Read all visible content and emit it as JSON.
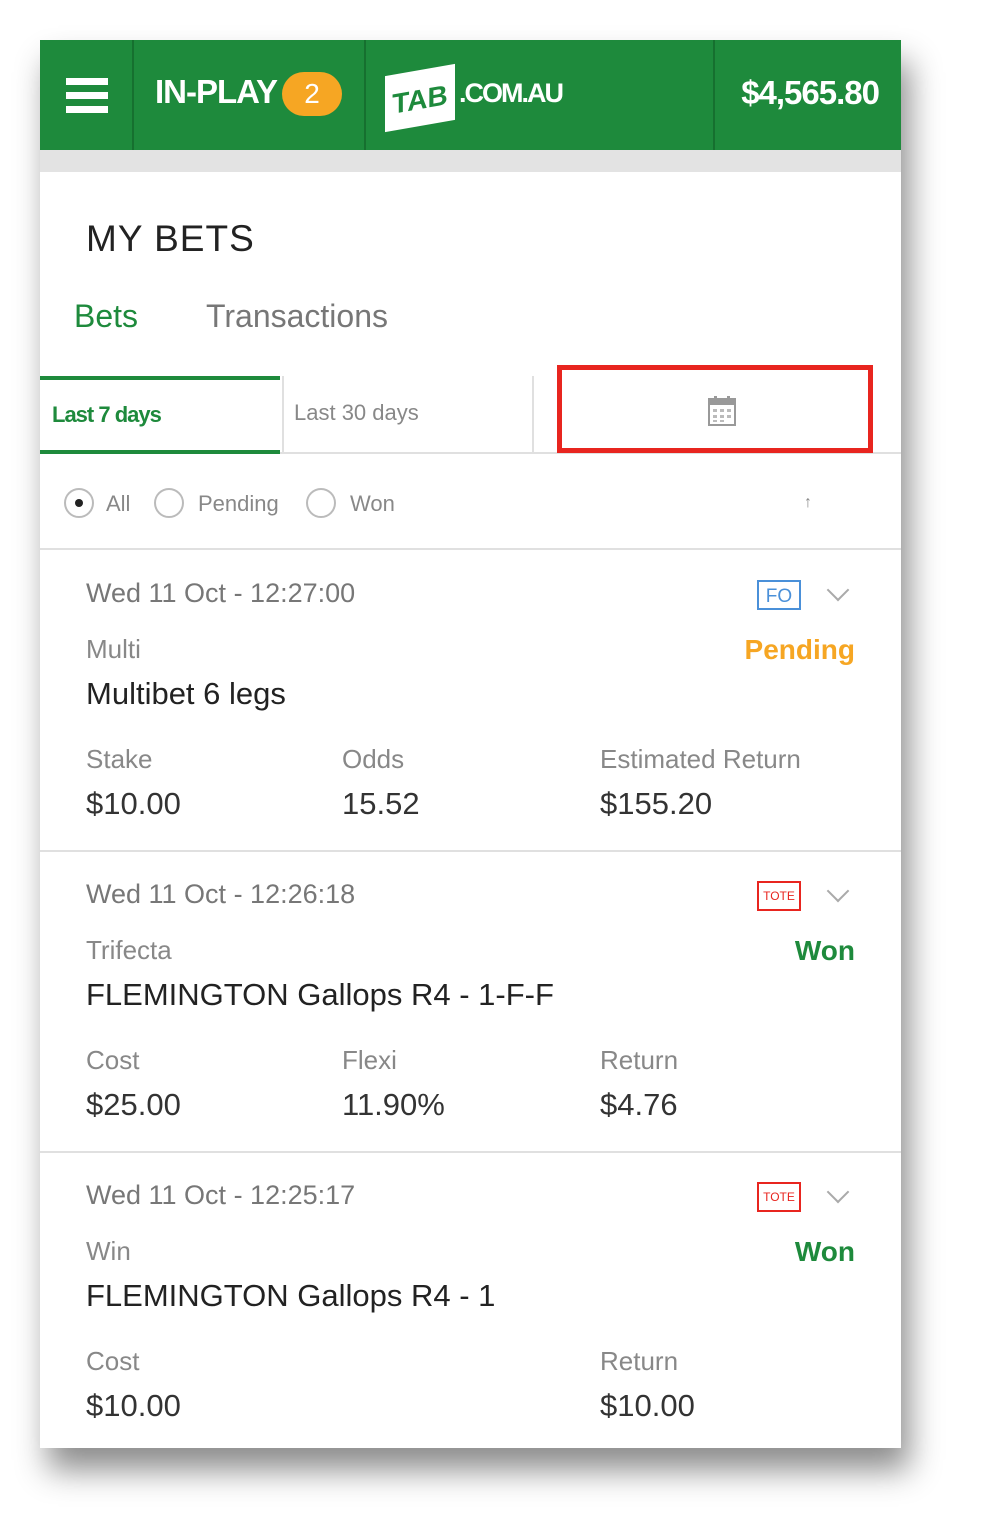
{
  "header": {
    "inplay_label": "IN-PLAY",
    "inplay_count": "2",
    "logo_tab": "TAB",
    "logo_com": ".COM.AU",
    "balance": "$4,565.80"
  },
  "page": {
    "title": "MY BETS",
    "tabs": [
      "Bets",
      "Transactions"
    ],
    "periods": [
      "Last 7 days",
      "Last 30 days"
    ],
    "filters": [
      "All",
      "Pending",
      "Won"
    ],
    "selected_filter": "All",
    "sort_icon": "↑"
  },
  "colors": {
    "brand": "#1e8a3c",
    "pending": "#f6a623",
    "won": "#1e8a3c",
    "highlight": "#e8251f"
  },
  "bets": [
    {
      "date": "Wed 11 Oct - 12:27:00",
      "badge": "FO",
      "type": "Multi",
      "status": "Pending",
      "desc": "Multibet 6 legs",
      "c1_label": "Stake",
      "c1_value": "$10.00",
      "c2_label": "Odds",
      "c2_value": "15.52",
      "c3_label": "Estimated Return",
      "c3_value": "$155.20"
    },
    {
      "date": "Wed 11 Oct - 12:26:18",
      "badge": "TOTE",
      "type": "Trifecta",
      "status": "Won",
      "desc": "FLEMINGTON Gallops R4 - 1-F-F",
      "c1_label": "Cost",
      "c1_value": "$25.00",
      "c2_label": "Flexi",
      "c2_value": "11.90%",
      "c3_label": "Return",
      "c3_value": "$4.76"
    },
    {
      "date": "Wed 11 Oct - 12:25:17",
      "badge": "TOTE",
      "type": "Win",
      "status": "Won",
      "desc": "FLEMINGTON Gallops R4 - 1",
      "c1_label": "Cost",
      "c1_value": "$10.00",
      "c3_label": "Return",
      "c3_value": "$10.00"
    }
  ]
}
